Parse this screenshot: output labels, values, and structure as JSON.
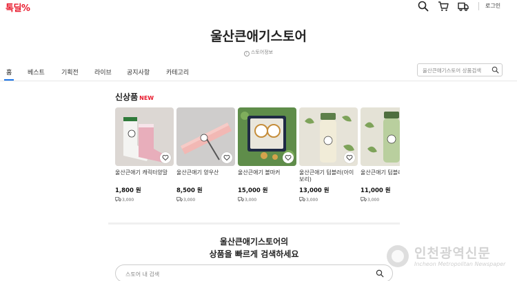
{
  "header": {
    "logo": "톡딜%",
    "login": "로그인",
    "icons": [
      "search-icon",
      "cart-icon",
      "delivery-truck-icon"
    ]
  },
  "store": {
    "title": "울산큰애기스토어",
    "info_label": "스토어정보"
  },
  "nav": {
    "tabs": [
      {
        "label": "홈",
        "active": true
      },
      {
        "label": "베스트",
        "active": false
      },
      {
        "label": "기획전",
        "active": false
      },
      {
        "label": "라이브",
        "active": false
      },
      {
        "label": "공지사항",
        "active": false
      },
      {
        "label": "카테고리",
        "active": false
      }
    ],
    "accent": "#1a73e8",
    "search_placeholder": "울산큰애기스토어 상품검색"
  },
  "new_products": {
    "title": "신상품",
    "badge": "NEW",
    "badge_color": "#e8192c",
    "items": [
      {
        "name": "울산큰애기 캐릭터양말",
        "price": "1,800 원",
        "shipping": "3,000"
      },
      {
        "name": "울산큰애기 양우산",
        "price": "8,500 원",
        "shipping": "3,000"
      },
      {
        "name": "울산큰애기 볼마커",
        "price": "15,000 원",
        "shipping": "3,000"
      },
      {
        "name": "울산큰애기 텀블러(아이보리)",
        "price": "13,000 원",
        "shipping": "3,000"
      },
      {
        "name": "울산큰애기 텀블러(그린)",
        "price": "11,000 원",
        "shipping": "3,000"
      }
    ]
  },
  "search_cta": {
    "line1": "울산큰애기스토어의",
    "line2": "상품을 빠르게 검색하세요",
    "placeholder": "스토어 내 검색"
  },
  "watermark": {
    "name": "인천광역신문",
    "english": "Incheon Metropolitan Newspaper"
  }
}
